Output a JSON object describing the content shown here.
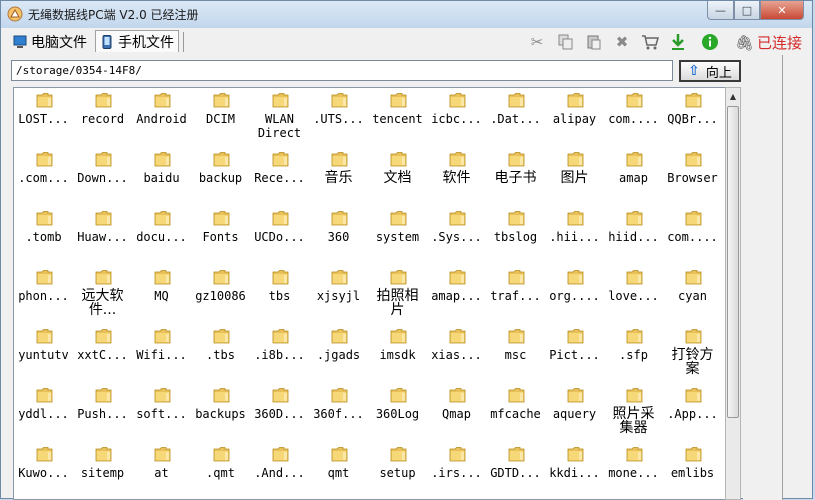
{
  "window": {
    "title": "无绳数据线PC端 V2.0 已经注册",
    "min_glyph": "—",
    "max_glyph": "□",
    "close_glyph": "✕"
  },
  "tabs": [
    {
      "label": "电脑文件",
      "icon": "monitor-icon"
    },
    {
      "label": "手机文件",
      "icon": "phone-icon"
    }
  ],
  "toolbar": {
    "icons": [
      "cut-icon",
      "copy-icon",
      "paste-icon",
      "delete-icon",
      "cart-icon",
      "download-icon",
      "info-icon"
    ],
    "status": "已连接",
    "status_color": "#d42a2a"
  },
  "path": {
    "value": "/storage/0354-14F8/",
    "up_label": "向上"
  },
  "folders": [
    "LOST...",
    "record",
    "Android",
    "DCIM",
    "WLAN\nDirect",
    ".UTS...",
    "tencent",
    "icbc...",
    ".Dat...",
    "alipay",
    "com....",
    "QQBr...",
    ".com...",
    "Down...",
    "baidu",
    "backup",
    "Rece...",
    "音乐",
    "文档",
    "软件",
    "电子书",
    "图片",
    "amap",
    "Browser",
    ".tomb",
    "Huaw...",
    "docu...",
    "Fonts",
    "UCDo...",
    "360",
    "system",
    ".Sys...",
    "tbslog",
    ".hii...",
    "hiid...",
    "com....",
    "phon...",
    "远大软\n件...",
    "MQ",
    "gz10086",
    "tbs",
    "xjsyjl",
    "拍照相\n片",
    "amap...",
    "traf...",
    "org....",
    "love...",
    "cyan",
    "yuntutv",
    "xxtC...",
    "Wifi...",
    ".tbs",
    ".i8b...",
    ".jgads",
    "imsdk",
    "xias...",
    "msc",
    "Pict...",
    ".sfp",
    "打铃方\n案",
    "yddl...",
    "Push...",
    "soft...",
    "backups",
    "360D...",
    "360f...",
    "360Log",
    "Qmap",
    "mfcache",
    "aquery",
    "照片采\n集器",
    ".App...",
    "Kuwo...",
    "sitemp",
    "at",
    ".qmt",
    ".And...",
    "qmt",
    "setup",
    ".irs...",
    "GDTD...",
    "kkdi...",
    "mone...",
    "emlibs"
  ]
}
